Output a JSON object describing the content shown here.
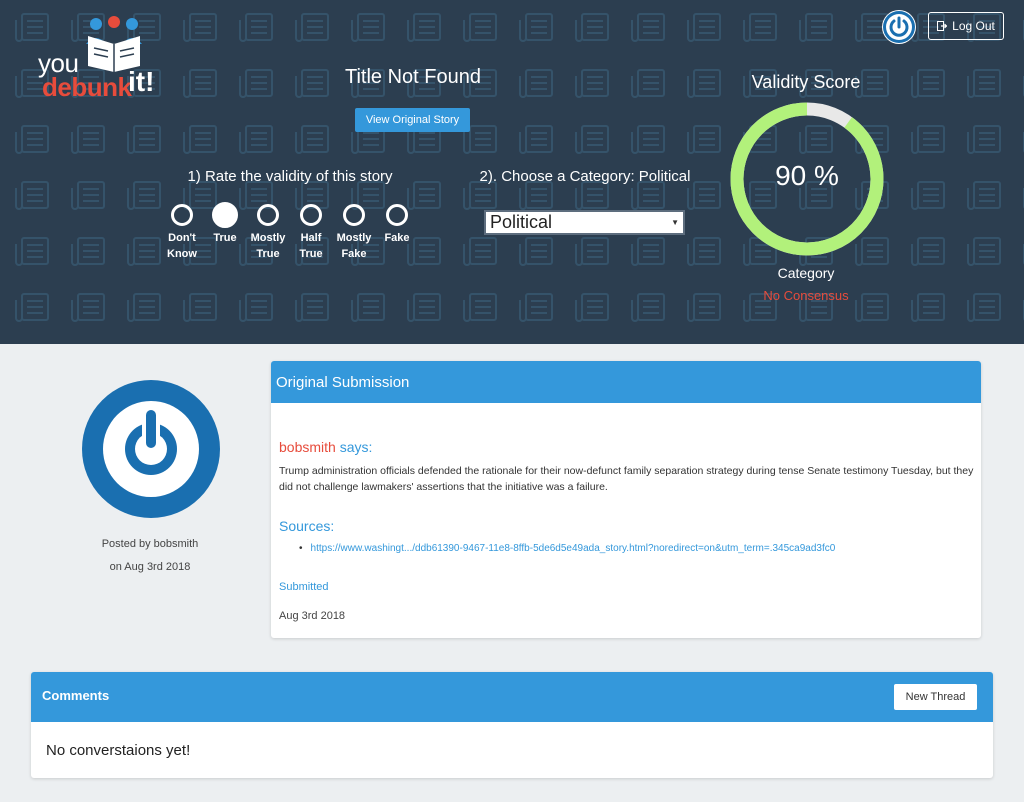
{
  "logo": {
    "you": "you",
    "debunk": "debunk",
    "it": "it!"
  },
  "header": {
    "logout_label": "Log Out"
  },
  "story": {
    "title": "Title Not Found",
    "view_original_label": "View Original Story"
  },
  "rating": {
    "title": "1) Rate the validity of this story",
    "options": [
      {
        "line1": "Don't",
        "line2": "Know",
        "checked": false
      },
      {
        "line1": "True",
        "line2": "",
        "checked": true
      },
      {
        "line1": "Mostly",
        "line2": "True",
        "checked": false
      },
      {
        "line1": "Half",
        "line2": "True",
        "checked": false
      },
      {
        "line1": "Mostly",
        "line2": "Fake",
        "checked": false
      },
      {
        "line1": "Fake",
        "line2": "",
        "checked": false
      }
    ]
  },
  "category": {
    "title": "2). Choose a Category: Political",
    "selected": "Political"
  },
  "validity": {
    "title": "Validity Score",
    "score_text": "90 %",
    "score_fraction": 0.9,
    "category_label": "Category",
    "consensus": "No Consensus",
    "colors": {
      "fill": "#b2f17b",
      "track": "#e8e8e8"
    }
  },
  "poster": {
    "posted_by": "Posted by bobsmith",
    "posted_on": "on Aug 3rd 2018"
  },
  "submission": {
    "header": "Original Submission",
    "username": "bobsmith",
    "says": "says:",
    "body": "Trump administration officials defended the rationale for their now-defunct family separation strategy during tense Senate testimony Tuesday, but they did not challenge lawmakers' assertions that the initiative was a failure.",
    "sources_title": "Sources:",
    "sources": [
      "https://www.washingt.../ddb61390-9467-11e8-8ffb-5de6d5e49ada_story.html?noredirect=on&utm_term=.345ca9ad3fc0"
    ],
    "submitted_label": "Submitted",
    "submitted_date": "Aug 3rd 2018"
  },
  "comments": {
    "header": "Comments",
    "new_thread_label": "New Thread",
    "empty": "No converstaions yet!"
  },
  "colors": {
    "accent": "#3498db",
    "hero_bg": "#2c3e50",
    "red": "#e74c3c"
  }
}
